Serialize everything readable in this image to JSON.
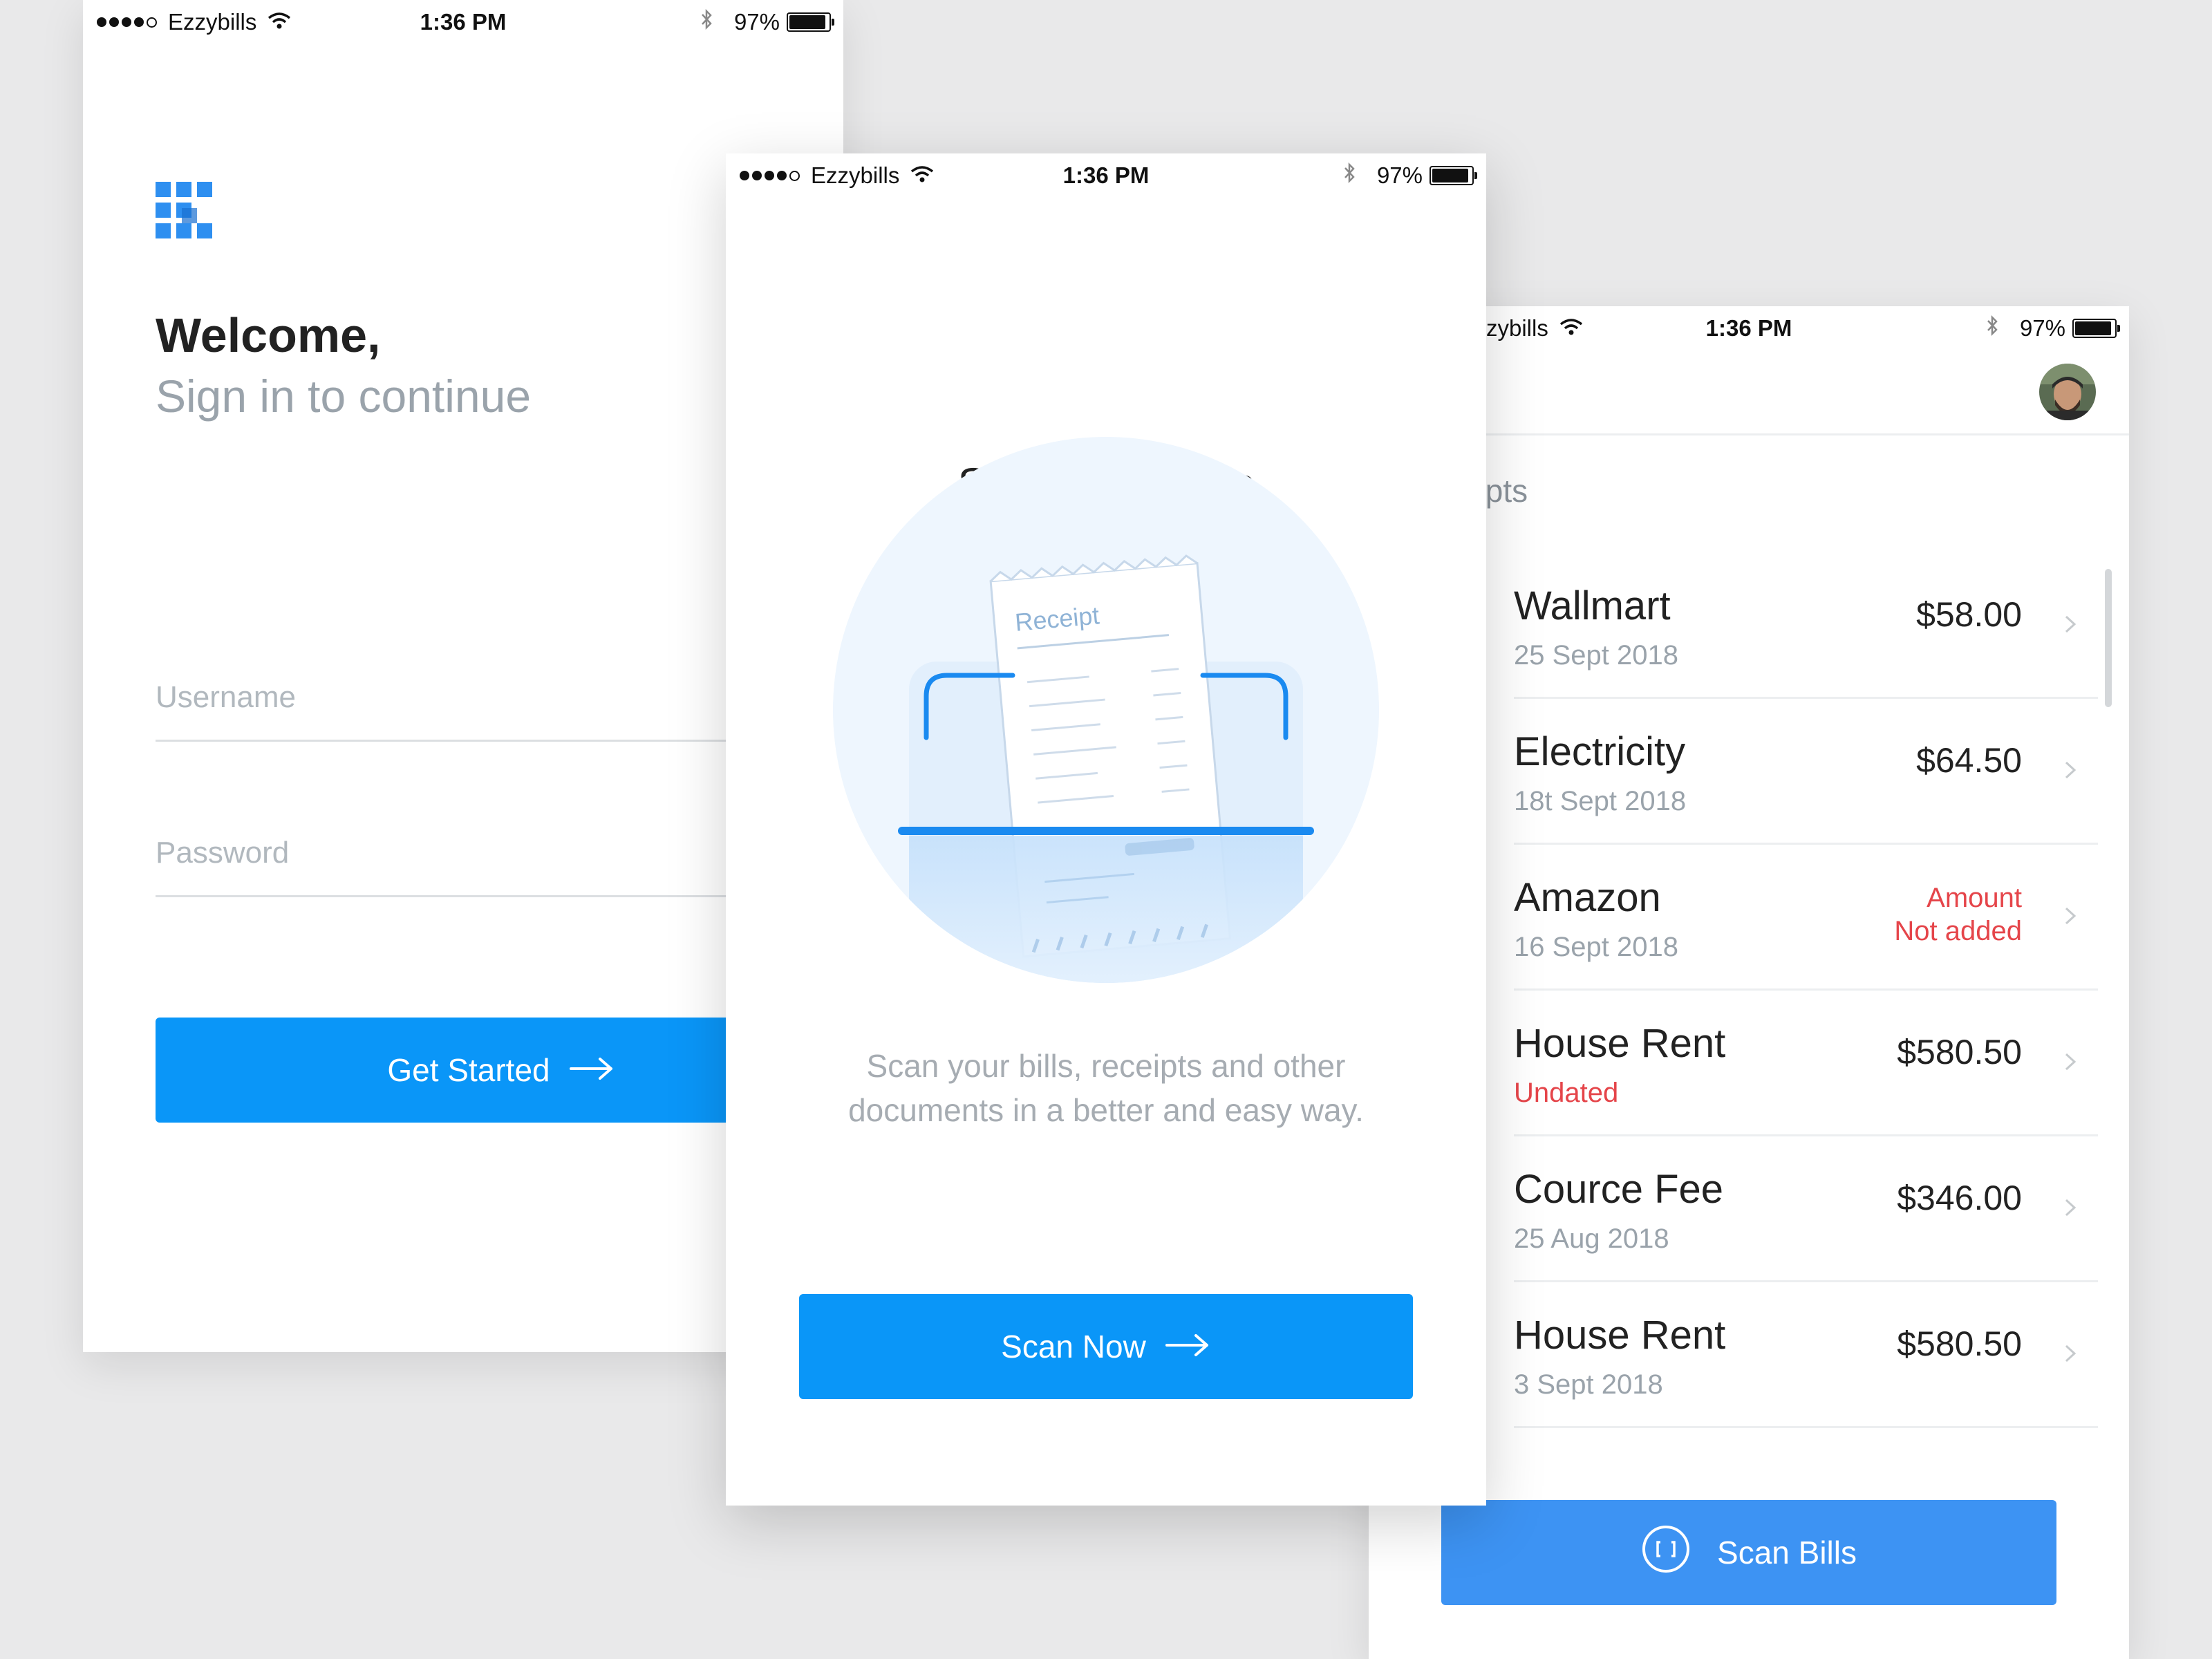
{
  "status_bar": {
    "carrier": "Ezzybills",
    "carrier_partial": "zybills",
    "time": "1:36 PM",
    "battery": "97%"
  },
  "signin": {
    "logo_icon": "grid-logo-icon",
    "welcome": "Welcome,",
    "subtitle": "Sign in to continue",
    "username_placeholder": "Username",
    "password_placeholder": "Password",
    "button_label": "Get Started"
  },
  "scan": {
    "title": "Scan your bills",
    "receipt_label": "Receipt",
    "description": "Scan your bills, receipts and other documents in a better and easy way.",
    "button_label": "Scan Now"
  },
  "receipts": {
    "section_title": "ceipts",
    "items": [
      {
        "name": "Wallmart",
        "date": "25 Sept 2018",
        "amount": "$58.00"
      },
      {
        "name": "Electricity",
        "date": "18t Sept 2018",
        "amount": "$64.50"
      },
      {
        "name": "Amazon",
        "date": "16 Sept 2018",
        "amount_line1": "Amount",
        "amount_line2": "Not added"
      },
      {
        "name": "House Rent",
        "date": "Undated",
        "amount": "$580.50"
      },
      {
        "name": "Cource Fee",
        "date": "25 Aug 2018",
        "amount": "$346.00"
      },
      {
        "name": "House Rent",
        "date": "3 Sept 2018",
        "amount": "$580.50"
      }
    ],
    "button_label": "Scan Bills"
  },
  "colors": {
    "primary": "#0a96f8",
    "scan_bills_button": "#3d93f3",
    "alert_red": "#e5454a",
    "muted_text": "#9aa3ab",
    "background": "#e9e9ea"
  }
}
